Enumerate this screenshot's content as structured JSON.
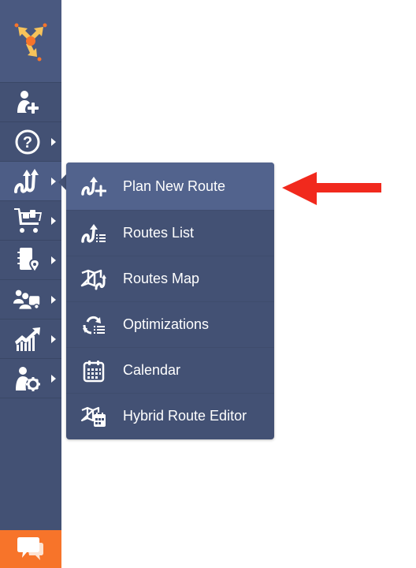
{
  "sidebar": {
    "logo_icon": "route4me-logo-icon",
    "items": [
      {
        "name": "add-customer",
        "icon": "user-add-icon",
        "has_submenu": false,
        "active": false
      },
      {
        "name": "help",
        "icon": "question-circle-icon",
        "has_submenu": true,
        "active": false
      },
      {
        "name": "routes",
        "icon": "routes-icon",
        "has_submenu": true,
        "active": true
      },
      {
        "name": "orders",
        "icon": "cart-icon",
        "has_submenu": true,
        "active": false
      },
      {
        "name": "address-book",
        "icon": "address-book-icon",
        "has_submenu": true,
        "active": false
      },
      {
        "name": "team",
        "icon": "team-vehicle-icon",
        "has_submenu": true,
        "active": false
      },
      {
        "name": "analytics",
        "icon": "analytics-chart-icon",
        "has_submenu": true,
        "active": false
      },
      {
        "name": "settings",
        "icon": "user-settings-icon",
        "has_submenu": true,
        "active": false
      }
    ],
    "chat_icon": "chat-bubbles-icon"
  },
  "submenu": {
    "items": [
      {
        "label": "Plan New Route",
        "icon": "plan-new-route-icon",
        "highlighted": true
      },
      {
        "label": "Routes List",
        "icon": "routes-list-icon",
        "highlighted": false
      },
      {
        "label": "Routes Map",
        "icon": "routes-map-icon",
        "highlighted": false
      },
      {
        "label": "Optimizations",
        "icon": "optimizations-icon",
        "highlighted": false
      },
      {
        "label": "Calendar",
        "icon": "calendar-icon",
        "highlighted": false
      },
      {
        "label": "Hybrid Route Editor",
        "icon": "hybrid-route-editor-icon",
        "highlighted": false
      }
    ]
  },
  "annotation": {
    "arrow_icon": "red-arrow-left-icon",
    "color": "#f1291d"
  },
  "colors": {
    "sidebar_bg": "#435174",
    "accent_orange": "#f7742a",
    "highlight_bg": "#52638d"
  }
}
